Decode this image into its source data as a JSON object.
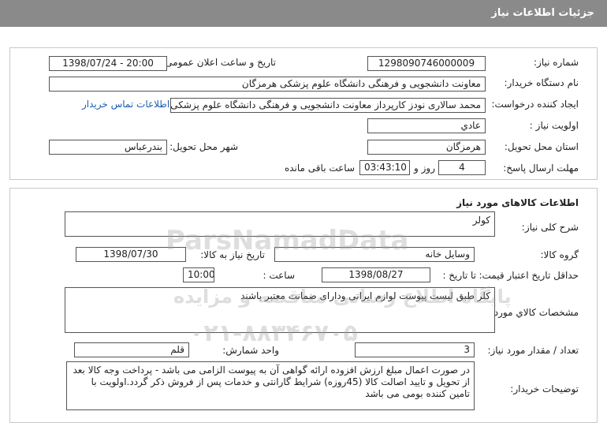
{
  "header": {
    "title": "جزئیات اطلاعات نیاز"
  },
  "need_info": {
    "need_number": {
      "label": "شماره نیاز:",
      "value": "1298090746000009"
    },
    "announce_datetime": {
      "label": "تاریخ و ساعت اعلان عمومی:",
      "value": "1398/07/24 - 20:00"
    },
    "buyer_org": {
      "label": "نام دستگاه خریدار:",
      "value": "معاونت دانشجویی و فرهنگی دانشگاه علوم پزشکی هرمزگان"
    },
    "requester": {
      "label": "ایجاد کننده درخواست:",
      "value": "محمد سالاری نودز کارپرداز معاونت دانشجویی و فرهنگی دانشگاه علوم پزشکی",
      "contact_link": "اطلاعات تماس خریدار"
    },
    "priority": {
      "label": "اولویت نیاز :",
      "value": "عادي"
    },
    "province": {
      "label": "استان محل تحویل:",
      "value": "هرمزگان"
    },
    "city": {
      "label": "شهر محل تحویل:",
      "value": "بندرعباس"
    },
    "deadline": {
      "label": "مهلت ارسال پاسخ:",
      "days": "4",
      "days_unit": "روز و",
      "time": "03:43:10",
      "time_suffix": "ساعت باقی مانده"
    }
  },
  "goods": {
    "title": "اطلاعات کالاهای مورد نیاز",
    "summary": {
      "label": "شرح کلی نیاز:",
      "value": "کولر"
    },
    "group": {
      "label": "گروه کالا:",
      "value": "وسایل خانه"
    },
    "need_date": {
      "label": "تاریخ نیاز به کالا:",
      "value": "1398/07/30"
    },
    "price_validity": {
      "label": "حداقل تاریخ اعتبار قیمت:",
      "to_date_label": "تا تاریخ :",
      "date": "1398/08/27",
      "time_label": "ساعت :",
      "time": "10:00"
    },
    "specs": {
      "label": "مشخصات کالاي مورد نیاز:",
      "value": "کلر طبق لیست پیوست لوازم ایرانی ودارای ضمانت معتبر باشند"
    },
    "quantity": {
      "label": "تعداد / مقدار مورد نیاز:",
      "value": "3"
    },
    "unit": {
      "label": "واحد شمارش:",
      "value": "قلم"
    },
    "buyer_notes": {
      "label": "توضیحات خریدار:",
      "value": "در صورت اعمال مبلغ ارزش افزوده ارائه گواهی آن به پیوست الزامی می باشد - پرداخت وجه کالا بعد از تحویل و تایید اصالت کالا (45روزه) شرایط گارانتی و خدمات پس از فروش ذکر گردد.اولویت با تامین کننده بومی می باشد"
    }
  },
  "watermark": {
    "brand": "ParsNamadData",
    "line1": "پایگاه اطلاع رسانی مناقصه و مزایده",
    "phone": "۰۲۱-۸۸۳۴۶۷۰۵"
  }
}
